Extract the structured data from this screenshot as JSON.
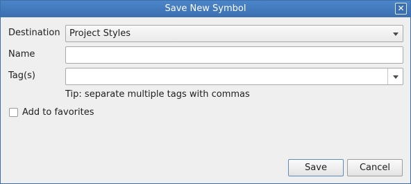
{
  "dialog": {
    "title": "Save New Symbol",
    "close_icon": "close-icon"
  },
  "form": {
    "destination_label": "Destination",
    "destination_value": "Project Styles",
    "name_label": "Name",
    "name_value": "",
    "tags_label": "Tag(s)",
    "tags_value": "",
    "tip": "Tip: separate multiple tags with commas",
    "favorites_label": "Add to favorites",
    "favorites_checked": false
  },
  "buttons": {
    "save_label": "Save",
    "cancel_label": "Cancel"
  },
  "colors": {
    "titlebar": "#3a6fb0",
    "title_text": "#ffffff",
    "background": "#efefef"
  }
}
